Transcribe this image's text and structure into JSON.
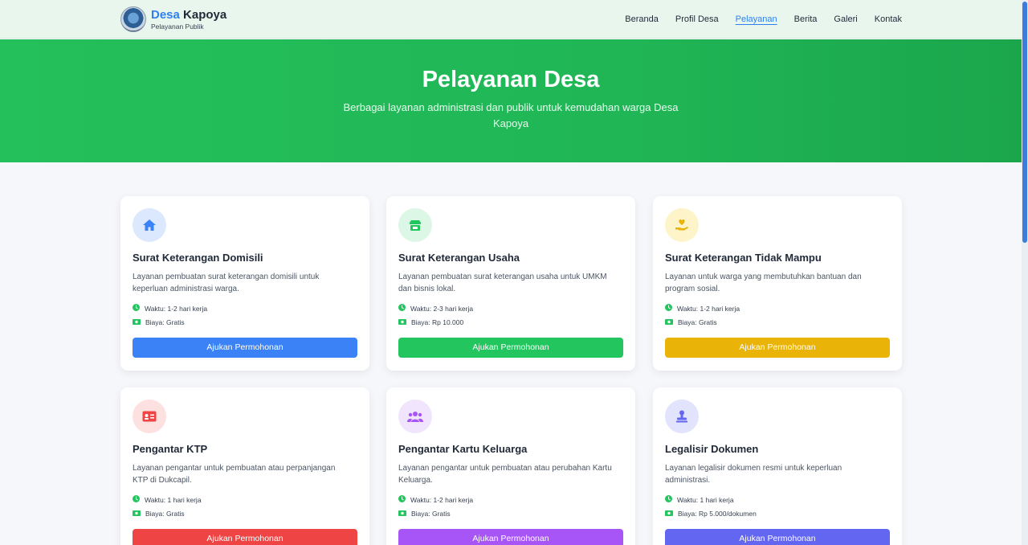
{
  "header": {
    "brand_part1": "Desa",
    "brand_part2": "Kapoya",
    "subtitle": "Pelayanan Publik",
    "nav": [
      {
        "label": "Beranda"
      },
      {
        "label": "Profil Desa"
      },
      {
        "label": "Pelayanan",
        "active": true
      },
      {
        "label": "Berita"
      },
      {
        "label": "Galeri"
      },
      {
        "label": "Kontak"
      }
    ]
  },
  "hero": {
    "title": "Pelayanan Desa",
    "subtitle": "Berbagai layanan administrasi dan publik untuk kemudahan warga Desa Kapoya"
  },
  "services": [
    {
      "title": "Surat Keterangan Domisili",
      "description": "Layanan pembuatan surat keterangan domisili untuk keperluan administrasi warga.",
      "time": "Waktu: 1-2 hari kerja",
      "cost": "Biaya: Gratis",
      "button": "Ajukan Permohonan",
      "icon": "home-icon",
      "color": "#3b82f6",
      "icon_bg": "#dbe8fd"
    },
    {
      "title": "Surat Keterangan Usaha",
      "description": "Layanan pembuatan surat keterangan usaha untuk UMKM dan bisnis lokal.",
      "time": "Waktu: 2-3 hari kerja",
      "cost": "Biaya: Rp 10.000",
      "button": "Ajukan Permohonan",
      "icon": "store-icon",
      "color": "#22c55e",
      "icon_bg": "#dcf7e6"
    },
    {
      "title": "Surat Keterangan Tidak Mampu",
      "description": "Layanan untuk warga yang membutuhkan bantuan dan program sosial.",
      "time": "Waktu: 1-2 hari kerja",
      "cost": "Biaya: Gratis",
      "button": "Ajukan Permohonan",
      "icon": "hand-holding-heart-icon",
      "color": "#eab308",
      "icon_bg": "#fdf5c9"
    },
    {
      "title": "Pengantar KTP",
      "description": "Layanan pengantar untuk pembuatan atau perpanjangan KTP di Dukcapil.",
      "time": "Waktu: 1 hari kerja",
      "cost": "Biaya: Gratis",
      "button": "Ajukan Permohonan",
      "icon": "id-card-icon",
      "color": "#ef4444",
      "icon_bg": "#fde0e0"
    },
    {
      "title": "Pengantar Kartu Keluarga",
      "description": "Layanan pengantar untuk pembuatan atau perubahan Kartu Keluarga.",
      "time": "Waktu: 1-2 hari kerja",
      "cost": "Biaya: Gratis",
      "button": "Ajukan Permohonan",
      "icon": "users-icon",
      "color": "#a855f7",
      "icon_bg": "#f1e4fd"
    },
    {
      "title": "Legalisir Dokumen",
      "description": "Layanan legalisir dokumen resmi untuk keperluan administrasi.",
      "time": "Waktu: 1 hari kerja",
      "cost": "Biaya: Rp 5.000/dokumen",
      "button": "Ajukan Permohonan",
      "icon": "stamp-icon",
      "color": "#6366f1",
      "icon_bg": "#e2e3fc"
    }
  ]
}
